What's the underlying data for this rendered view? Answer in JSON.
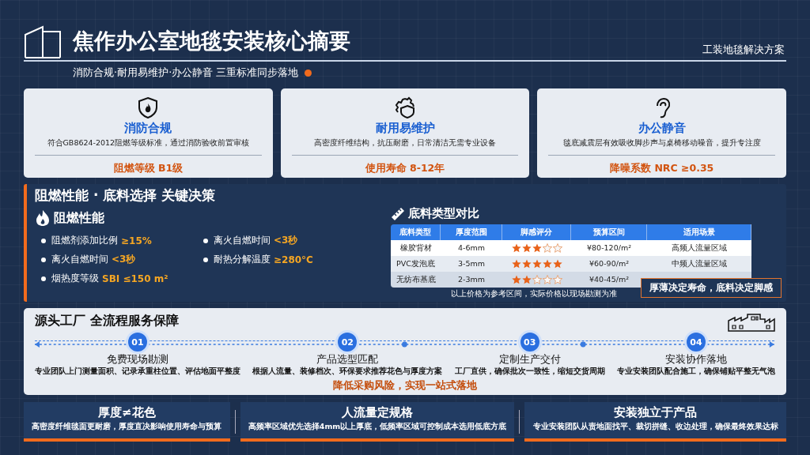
{
  "header": {
    "title": "焦作办公室地毯安装核心摘要",
    "subtitle": "消防合规·耐用易维护·办公静音 三重标准同步落地",
    "tag": "工装地毯解决方案"
  },
  "features": [
    {
      "title": "消防合规",
      "desc": "符合GB8624-2012阻燃等级标准，通过消防验收前置审核",
      "metric": "阻燃等级 B1级"
    },
    {
      "title": "耐用易维护",
      "desc": "高密度纤维结构，抗压耐磨，日常清洁无需专业设备",
      "metric": "使用寿命 8-12年"
    },
    {
      "title": "办公静音",
      "desc": "毯底减震层有效吸收脚步声与桌椅移动噪音，提升专注度",
      "metric": "降噪系数 NRC ≥0.35"
    }
  ],
  "decision": {
    "title": "阻燃性能 · 底料选择 关键决策",
    "fire": {
      "title": "阻燃性能",
      "items": [
        {
          "label": "阻燃剂添加比例",
          "value": "≥15%"
        },
        {
          "label": "离火自燃时间",
          "value": "<3秒"
        },
        {
          "label": "离火自燃时间",
          "value": "<3秒"
        },
        {
          "label": "耐热分解温度",
          "value": "≥280°C"
        },
        {
          "label": "烟热度等级",
          "value": " SBI ≤150 m²"
        }
      ]
    },
    "table": {
      "title": "底料类型对比",
      "columns": [
        "底料类型",
        "厚度范围",
        "脚感评分",
        "预算区间",
        "适用场景"
      ],
      "rows": [
        {
          "cells": [
            "橡胶背材",
            "4-6mm",
            "",
            "¥80-120/m²",
            "高频人流量区域"
          ],
          "stars": 3
        },
        {
          "cells": [
            "PVC发泡底",
            "3-5mm",
            "",
            "¥60-90/m²",
            "中频人流量区域"
          ],
          "stars": 5
        },
        {
          "cells": [
            "无纺布基底",
            "2-3mm",
            "",
            "¥40-45/m²"
          ],
          "stars": 2
        }
      ],
      "note": "以上价格为参考区间，实际价格以现场勘测为准"
    },
    "callout": "厚薄决定寿命，底料决定脚感"
  },
  "process": {
    "title": "源头工厂 全流程服务保障",
    "steps": [
      {
        "number": "01",
        "title": "免费现场勘测",
        "desc": "专业团队上门测量面积、记录承重柱位置、评估地面平整度"
      },
      {
        "number": "02",
        "title": "产品选型匹配",
        "desc": "根据人流量、装修档次、环保要求推荐花色与厚度方案"
      },
      {
        "number": "03",
        "title": "定制生产交付",
        "desc": "工厂直供，确保批次一致性，缩短交货周期"
      },
      {
        "number": "04",
        "title": "安装协作落地",
        "desc": "专业安装团队配合施工，确保铺贴平整无气泡"
      }
    ],
    "summary": "降低采购风险，实现一站式落地"
  },
  "tips": [
    {
      "title": "厚度≠花色",
      "desc": "高密度纤维毯面更耐磨，厚度直决影响使用寿命与预算"
    },
    {
      "title": "人流量定规格",
      "desc": "高频率区域优先选择4mm以上厚底，低频率区域可控制成本选用低底方底"
    },
    {
      "title": "安装独立于产品",
      "desc": "专业安装团队从责地面找平、裁切拼缝、收边处理，确保最终效果达标"
    }
  ]
}
